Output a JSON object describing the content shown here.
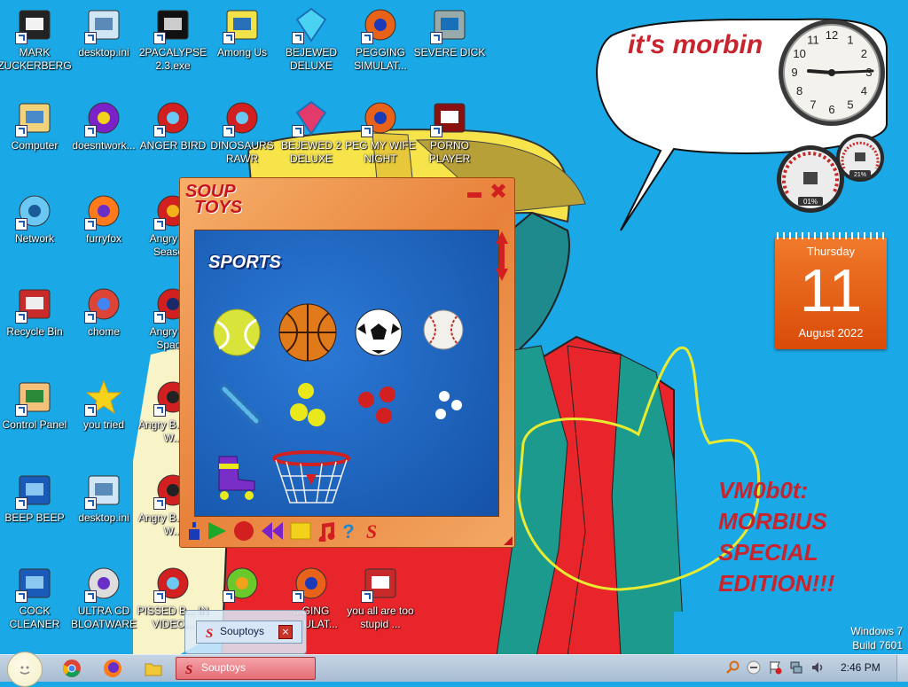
{
  "desktop": {
    "speech_bubble_text": "it's morbin",
    "signature_lines": [
      "VM0b0t:",
      "MORBIUS",
      "SPECIAL",
      "EDITION!!!"
    ],
    "windows_info": [
      "Windows 7",
      "Build 7601"
    ],
    "icons": [
      {
        "label": "MARK ZUCKERBERG",
        "icon": "person-photo-icon"
      },
      {
        "label": "desktop.ini",
        "icon": "settings-file-icon"
      },
      {
        "label": "2PACALYPSE 2.3.exe",
        "icon": "console-app-icon"
      },
      {
        "label": "Among Us",
        "icon": "among-us-icon"
      },
      {
        "label": "BEJEWED DELUXE",
        "icon": "gem-icon"
      },
      {
        "label": "PEGGING SIMULAT...",
        "icon": "p-game-icon"
      },
      {
        "label": "SEVERE DICK",
        "icon": "gear-sd-icon"
      },
      {
        "label": "Computer",
        "icon": "computer-icon"
      },
      {
        "label": "doesntwork...",
        "icon": "yahoo-messenger-icon"
      },
      {
        "label": "ANGER BIRD",
        "icon": "angry-bird-icon"
      },
      {
        "label": "DINOSAURS RAWR",
        "icon": "angry-bird-icon"
      },
      {
        "label": "BEJEWED 2 DELUXE",
        "icon": "gem-two-icon"
      },
      {
        "label": "PEG MY WIFE NIGHT",
        "icon": "p-game-icon"
      },
      {
        "label": "PORNO PLAYER",
        "icon": "flash-icon"
      },
      {
        "label": "Network",
        "icon": "network-globe-icon"
      },
      {
        "label": "furryfox",
        "icon": "firefox-icon"
      },
      {
        "label": "Angry B... Seaso...",
        "icon": "angry-bird-seasons-icon"
      },
      {
        "label": "Recycle Bin",
        "icon": "recycle-bin-icon"
      },
      {
        "label": "chome",
        "icon": "chrome-icon"
      },
      {
        "label": "Angry B... Spac...",
        "icon": "angry-bird-space-icon"
      },
      {
        "label": "Control Panel",
        "icon": "control-panel-icon"
      },
      {
        "label": "you tried",
        "icon": "star-icon"
      },
      {
        "label": "Angry B... Star W...",
        "icon": "angry-bird-starwars-icon"
      },
      {
        "label": "BEEP BEEP",
        "icon": "blue-book-icon"
      },
      {
        "label": "desktop.ini",
        "icon": "settings-file-icon"
      },
      {
        "label": "Angry B... Star W...",
        "icon": "angry-bird-starwars-icon"
      },
      {
        "label": "COCK CLEANER",
        "icon": "blue-book-icon"
      },
      {
        "label": "ULTRA CD BLOATWARE",
        "icon": "cd-icon"
      },
      {
        "label": "PISSED B... IN VIDEO...",
        "icon": "angry-bird-icon"
      },
      {
        "label": "",
        "icon": "bad-piggies-icon"
      },
      {
        "label": "...GING SIMULAT...",
        "icon": "p-game-icon"
      },
      {
        "label": "you all are too stupid ...",
        "icon": "dev-cpp-icon"
      }
    ]
  },
  "gadgets": {
    "clock": {
      "numerals": [
        "12",
        "1",
        "2",
        "3",
        "4",
        "5",
        "6",
        "7",
        "8",
        "9",
        "10",
        "11"
      ],
      "time_shown": "9:45"
    },
    "meter": {
      "cpu_percent": "01%",
      "ram_percent": "21%"
    },
    "calendar": {
      "weekday": "Thursday",
      "day": "11",
      "month_year": "August 2022"
    }
  },
  "souptoys": {
    "logo_top": "SOUP",
    "logo_bottom": "TOYS",
    "category": "SPORTS",
    "toys": [
      "tennis-ball-icon",
      "basketball-icon",
      "soccer-ball-icon",
      "baseball-icon",
      "dumbbell-icon",
      "yellow-balls-icon",
      "red-balls-icon",
      "white-balls-icon",
      "rollerskate-icon",
      "basketball-hoop-icon"
    ],
    "toolbar": [
      "download-icon",
      "play-icon",
      "record-icon",
      "rewind-icon",
      "stop-icon",
      "note-icon",
      "help-icon",
      "soup-logo-icon"
    ]
  },
  "taskbar": {
    "task_label": "Souptoys",
    "preview_label": "Souptoys",
    "time": "2:46 PM",
    "pinned": [
      "chrome-icon",
      "firefox-icon",
      "folder-icon"
    ],
    "tray": [
      "search-icon",
      "messenger-icon",
      "flag-icon",
      "network-icon",
      "volume-icon"
    ]
  },
  "colors": {
    "desktop": "#1aa8e6",
    "accent_red": "#c8242e",
    "calendar_orange": "#e8621a",
    "taskbar": "#b8cadc"
  }
}
